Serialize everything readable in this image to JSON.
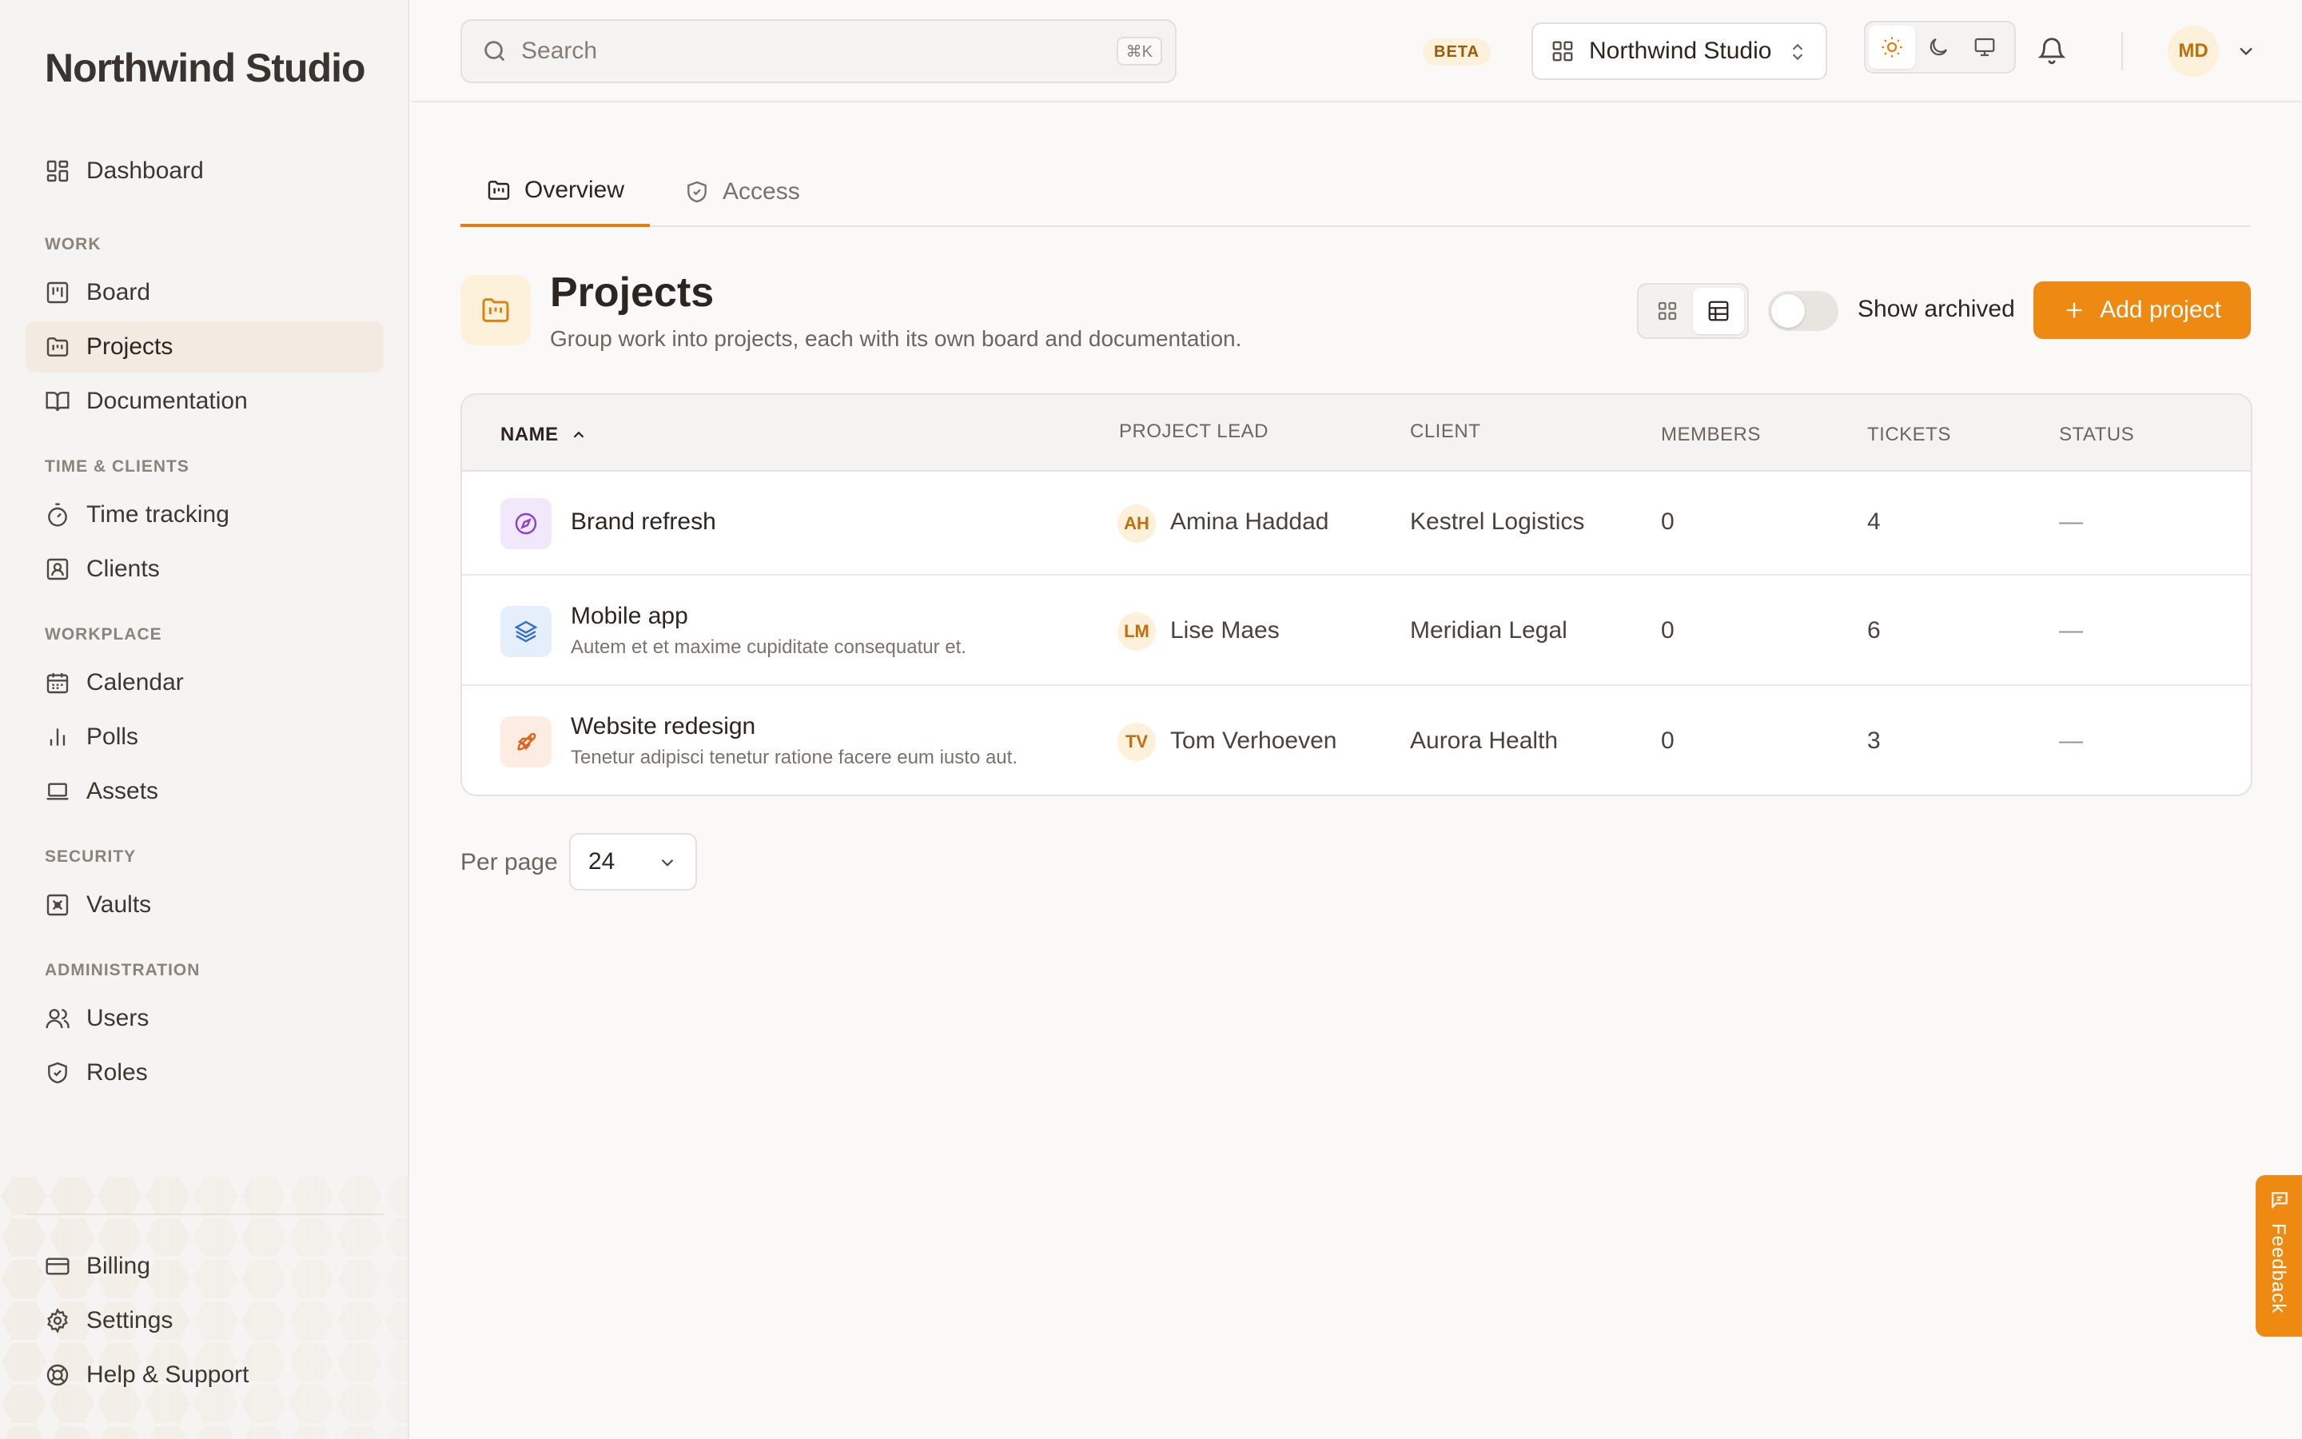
{
  "brand": "Northwind Studio",
  "colors": {
    "accent": "#ee8a12",
    "accent_soft": "#fdf1dc",
    "sidebar_bg": "#f5f4f2"
  },
  "sidebar": {
    "dashboard": "Dashboard",
    "sections": {
      "work": "WORK",
      "time_clients": "TIME & CLIENTS",
      "workplace": "WORKPLACE",
      "security": "SECURITY",
      "administration": "ADMINISTRATION"
    },
    "items": {
      "board": "Board",
      "projects": "Projects",
      "documentation": "Documentation",
      "time_tracking": "Time tracking",
      "clients": "Clients",
      "calendar": "Calendar",
      "polls": "Polls",
      "assets": "Assets",
      "vaults": "Vaults",
      "users": "Users",
      "roles": "Roles"
    },
    "footer": {
      "billing": "Billing",
      "settings": "Settings",
      "help": "Help & Support"
    },
    "active": "projects"
  },
  "header": {
    "search_placeholder": "Search",
    "search_shortcut": "⌘K",
    "beta": "BETA",
    "workspace": "Northwind Studio",
    "theme_active": "light",
    "user_initials": "MD"
  },
  "tabs": {
    "overview": "Overview",
    "access": "Access",
    "active": "overview"
  },
  "page": {
    "title": "Projects",
    "subtitle": "Group work into projects, each with its own board and documentation.",
    "view_mode": "table",
    "show_archived_label": "Show archived",
    "show_archived": false,
    "add_button": "Add project"
  },
  "table": {
    "columns": {
      "name": "NAME",
      "lead": "PROJECT LEAD",
      "client": "CLIENT",
      "members": "MEMBERS",
      "tickets": "TICKETS",
      "status": "STATUS"
    },
    "sort": "name-asc",
    "rows": [
      {
        "name": "Brand refresh",
        "desc": "",
        "icon": "compass-icon",
        "icon_bg": "#f1e9fb",
        "icon_color": "#8a3fd6",
        "lead_initials": "AH",
        "lead": "Amina Haddad",
        "client": "Kestrel Logistics",
        "members": "0",
        "tickets": "4",
        "status": "—"
      },
      {
        "name": "Mobile app",
        "desc": "Autem et et maxime cupiditate consequatur et.",
        "icon": "layers-icon",
        "icon_bg": "#e5eefb",
        "icon_color": "#2f6fd0",
        "lead_initials": "LM",
        "lead": "Lise Maes",
        "client": "Meridian Legal",
        "members": "0",
        "tickets": "6",
        "status": "—"
      },
      {
        "name": "Website redesign",
        "desc": "Tenetur adipisci tenetur ratione facere eum iusto aut.",
        "icon": "rocket-icon",
        "icon_bg": "#fdece1",
        "icon_color": "#e0621a",
        "lead_initials": "TV",
        "lead": "Tom Verhoeven",
        "client": "Aurora Health",
        "members": "0",
        "tickets": "3",
        "status": "—"
      }
    ]
  },
  "pagination": {
    "per_page_label": "Per page",
    "per_page": "24"
  },
  "feedback": "Feedback"
}
